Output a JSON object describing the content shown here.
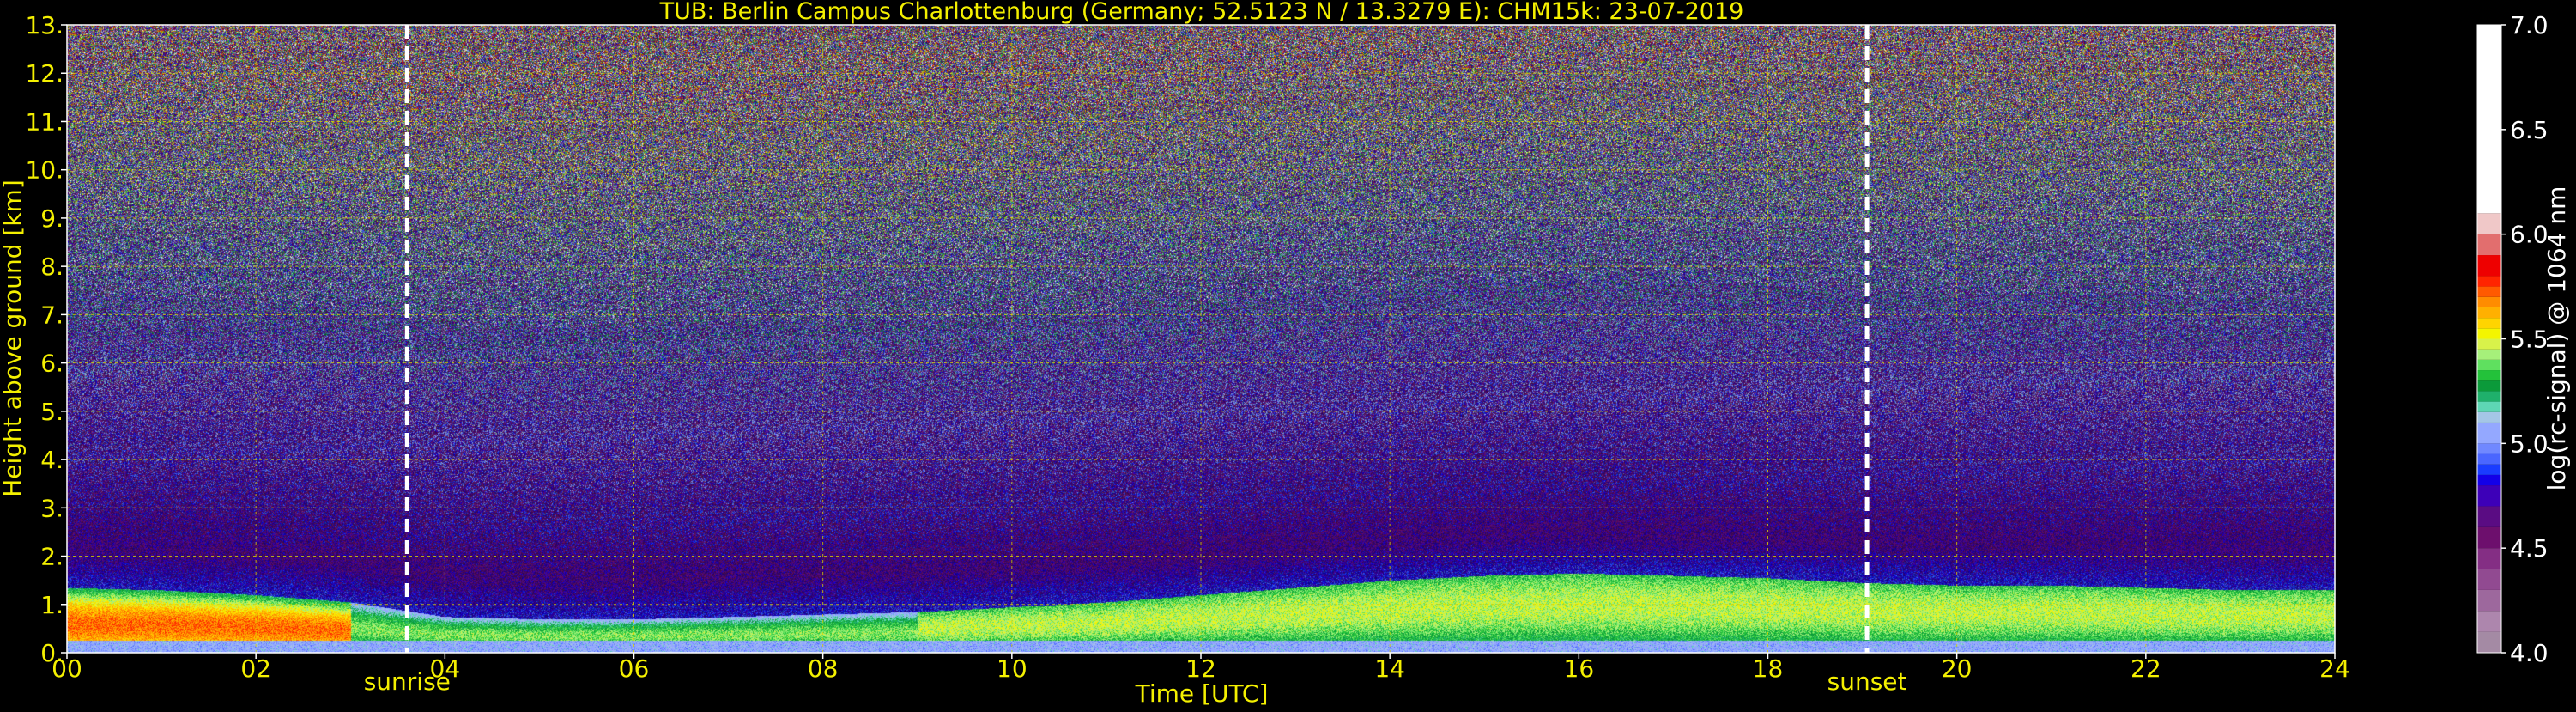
{
  "chart_data": {
    "type": "heatmap",
    "title": "TUB: Berlin Campus Charlottenburg (Germany; 52.5123 N / 13.3279 E):    CHM15k: 23-07-2019",
    "xlabel": "Time [UTC]",
    "ylabel": "Height above ground [km]",
    "xlim": [
      0,
      24
    ],
    "ylim": [
      0,
      13
    ],
    "x_ticks": [
      "00",
      "02",
      "04",
      "06",
      "08",
      "10",
      "12",
      "14",
      "16",
      "18",
      "20",
      "22",
      "24"
    ],
    "x_tick_values": [
      0,
      2,
      4,
      6,
      8,
      10,
      12,
      14,
      16,
      18,
      20,
      22,
      24
    ],
    "y_ticks": [
      "0.",
      "1.",
      "2.",
      "3.",
      "4.",
      "5.",
      "6.",
      "7.",
      "8.",
      "9.",
      "10.",
      "11.",
      "12.",
      "13."
    ],
    "y_tick_values": [
      0,
      1,
      2,
      3,
      4,
      5,
      6,
      7,
      8,
      9,
      10,
      11,
      12,
      13
    ],
    "grid": true,
    "annotations": [
      {
        "label": "sunrise",
        "x": 3.6
      },
      {
        "label": "sunset",
        "x": 19.05
      }
    ],
    "colorbar": {
      "label": "log(rc-signal) @ 1064 nm",
      "range": [
        4.0,
        7.0
      ],
      "ticks": [
        "4.0",
        "4.5",
        "5.0",
        "5.5",
        "6.0",
        "6.5",
        "7.0"
      ],
      "tick_values": [
        4.0,
        4.5,
        5.0,
        5.5,
        6.0,
        6.5,
        7.0
      ],
      "colors": [
        {
          "from": 4.0,
          "to": 4.1,
          "color": "#a48aa4"
        },
        {
          "from": 4.1,
          "to": 4.2,
          "color": "#ad86ad"
        },
        {
          "from": 4.2,
          "to": 4.3,
          "color": "#9d689d"
        },
        {
          "from": 4.3,
          "to": 4.4,
          "color": "#914a91"
        },
        {
          "from": 4.4,
          "to": 4.5,
          "color": "#842e84"
        },
        {
          "from": 4.5,
          "to": 4.6,
          "color": "#6d0f6d"
        },
        {
          "from": 4.6,
          "to": 4.7,
          "color": "#5a0c83"
        },
        {
          "from": 4.7,
          "to": 4.8,
          "color": "#3d00b8"
        },
        {
          "from": 4.8,
          "to": 4.85,
          "color": "#1300e8"
        },
        {
          "from": 4.85,
          "to": 4.9,
          "color": "#1a3cff"
        },
        {
          "from": 4.9,
          "to": 4.95,
          "color": "#4a66ff"
        },
        {
          "from": 4.95,
          "to": 5.0,
          "color": "#7088ff"
        },
        {
          "from": 5.0,
          "to": 5.1,
          "color": "#94a8ff"
        },
        {
          "from": 5.1,
          "to": 5.15,
          "color": "#a4c6e6"
        },
        {
          "from": 5.15,
          "to": 5.2,
          "color": "#5ed6b4"
        },
        {
          "from": 5.2,
          "to": 5.25,
          "color": "#1fb06b"
        },
        {
          "from": 5.25,
          "to": 5.3,
          "color": "#0b9a3a"
        },
        {
          "from": 5.3,
          "to": 5.35,
          "color": "#23c23a"
        },
        {
          "from": 5.35,
          "to": 5.4,
          "color": "#5fe05f"
        },
        {
          "from": 5.4,
          "to": 5.45,
          "color": "#a6f07a"
        },
        {
          "from": 5.45,
          "to": 5.5,
          "color": "#d8f24a"
        },
        {
          "from": 5.5,
          "to": 5.55,
          "color": "#f4f500"
        },
        {
          "from": 5.55,
          "to": 5.6,
          "color": "#ffd400"
        },
        {
          "from": 5.6,
          "to": 5.65,
          "color": "#ffb000"
        },
        {
          "from": 5.65,
          "to": 5.7,
          "color": "#ff8c00"
        },
        {
          "from": 5.7,
          "to": 5.75,
          "color": "#ff5a00"
        },
        {
          "from": 5.75,
          "to": 5.8,
          "color": "#ff2400"
        },
        {
          "from": 5.8,
          "to": 5.9,
          "color": "#ee0000"
        },
        {
          "from": 5.9,
          "to": 6.0,
          "color": "#e26e6e"
        },
        {
          "from": 6.0,
          "to": 6.1,
          "color": "#f0c8c8"
        },
        {
          "from": 6.1,
          "to": 7.0,
          "color": "#ffffff"
        }
      ]
    },
    "structures": [
      {
        "kind": "boundary_layer_top",
        "x": [
          0,
          1,
          2,
          3,
          4,
          5,
          6,
          7,
          8,
          9,
          10,
          11,
          12,
          13,
          14,
          15,
          16,
          17,
          18,
          19,
          20,
          21,
          22,
          23,
          24
        ],
        "y": [
          1.35,
          1.3,
          1.2,
          1.05,
          0.75,
          0.7,
          0.7,
          0.75,
          0.8,
          0.85,
          0.95,
          1.05,
          1.2,
          1.35,
          1.5,
          1.6,
          1.65,
          1.6,
          1.55,
          1.45,
          1.4,
          1.4,
          1.35,
          1.3,
          1.3
        ]
      }
    ],
    "noise_top_km": 13
  }
}
